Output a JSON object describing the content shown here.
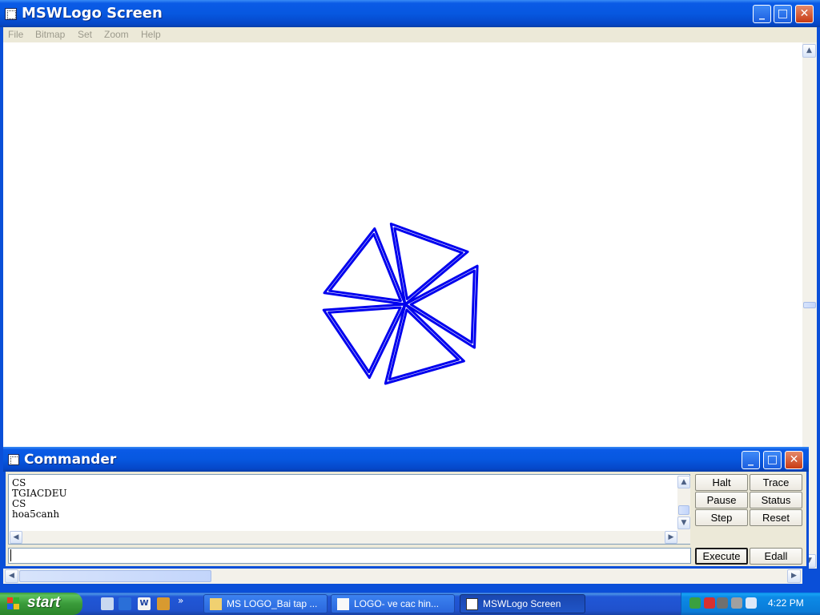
{
  "main_window": {
    "title": "MSWLogo Screen",
    "menu": [
      "File",
      "Bitmap",
      "Set",
      "Zoom",
      "Help"
    ],
    "controls": {
      "minimize": "_",
      "maximize": "□",
      "close": "✕"
    }
  },
  "drawing": {
    "description_free": true,
    "pen_color": "#0000ee",
    "background": "#ffffff"
  },
  "commander": {
    "title": "Commander",
    "history": [
      "CS",
      "TGIACDEU",
      "CS",
      "hoa5canh"
    ],
    "input_value": "",
    "buttons": {
      "halt": "Halt",
      "trace": "Trace",
      "pause": "Pause",
      "status": "Status",
      "step": "Step",
      "reset": "Reset",
      "execute": "Execute",
      "edall": "Edall"
    }
  },
  "taskbar": {
    "start_label": "start",
    "quick_launch": [
      "notepad-icon",
      "ie-icon",
      "word-icon",
      "app-icon"
    ],
    "overflow": "»",
    "tasks": [
      {
        "label": "MS LOGO_Bai tap ...",
        "icon": "folder-icon",
        "active": false
      },
      {
        "label": "LOGO- ve cac hin...",
        "icon": "word-doc-icon",
        "active": false
      },
      {
        "label": "MSWLogo Screen",
        "icon": "logo-app-icon",
        "active": true
      }
    ],
    "clock": "4:22 PM"
  }
}
